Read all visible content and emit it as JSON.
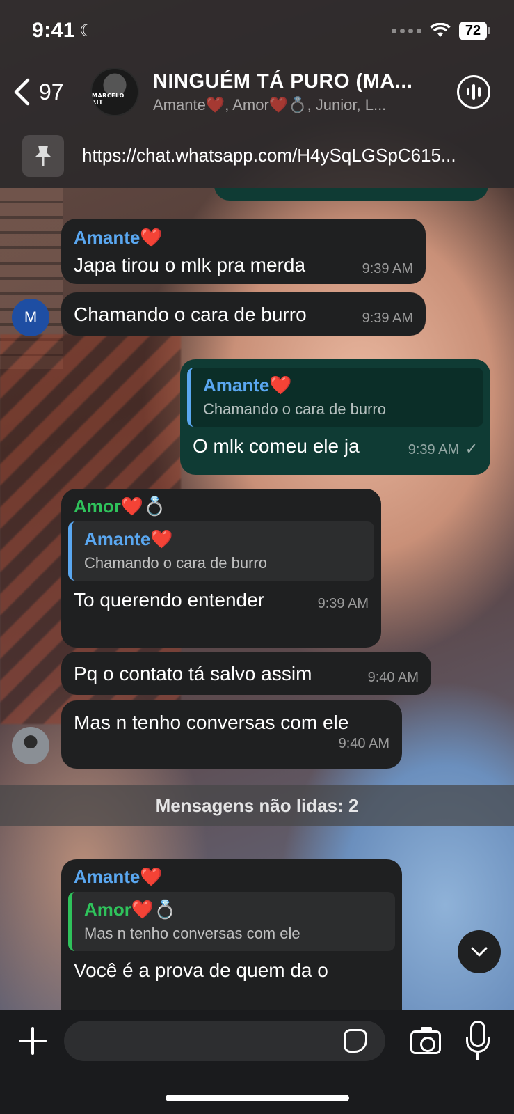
{
  "status_bar": {
    "time": "9:41",
    "battery": "72"
  },
  "header": {
    "back_count": "97",
    "group_title": "NINGUÉM TÁ PURO (MA...",
    "members": "Amante❤️, Amor❤️💍, Junior, L...",
    "avatar_text": "MARCELO XIT",
    "pinned_link": "https://chat.whatsapp.com/H4ySqLGSpC615..."
  },
  "messages": [
    {
      "sender": "Amante❤️",
      "text": "Japa tirou o mlk pra merda",
      "time": "9:39 AM"
    },
    {
      "text": "Chamando o cara de burro",
      "time": "9:39 AM",
      "avatar": "M"
    },
    {
      "quote_name": "Amante❤️",
      "quote_text": "Chamando o cara de burro",
      "text": "O mlk comeu ele ja",
      "time": "9:39 AM"
    },
    {
      "sender": "Amor❤️💍",
      "quote_name": "Amante❤️",
      "quote_text": "Chamando o cara de burro",
      "text": "To querendo entender",
      "time": "9:39 AM"
    },
    {
      "text": "Pq o contato tá salvo assim",
      "time": "9:40 AM"
    },
    {
      "text": "Mas n tenho conversas com ele",
      "time": "9:40 AM"
    },
    {
      "sender": "Amante❤️",
      "quote_name": "Amor❤️💍",
      "quote_text": "Mas n tenho conversas com ele",
      "text": "Você é a prova de quem da o"
    }
  ],
  "unread_label": "Mensagens não lidas: 2",
  "composer": {
    "placeholder": ""
  },
  "icons": [
    "back-chevron-icon",
    "call-waveform-icon",
    "pin-icon",
    "plus-icon",
    "sticker-icon",
    "camera-icon",
    "microphone-icon",
    "chevron-down-icon",
    "double-check-icon"
  ]
}
